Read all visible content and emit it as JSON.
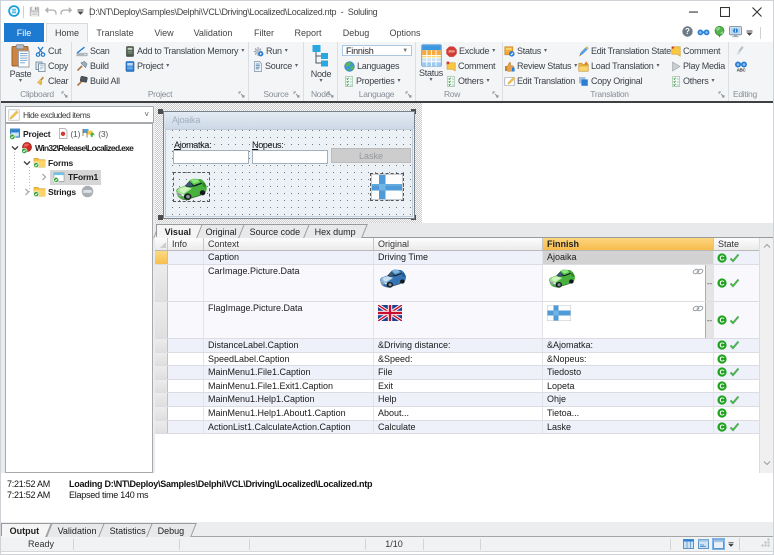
{
  "colors": {
    "accent_blue": "#1e79d0",
    "ribbon_bg": "#f4f5f7",
    "finnish_header_orange": "#f7bb4c",
    "state_green": "#1fa31f",
    "check_green": "#4caf50",
    "selected_row_yellow": "#f6c04f"
  },
  "titlebar": {
    "title_path": "D:\\NT\\Deploy\\Samples\\Delphi\\VCL\\Driving\\Localized\\Localized.ntp",
    "separator": "-",
    "app_name": "Soluling"
  },
  "ribbon_tabs": {
    "file": "File",
    "home": "Home",
    "translate": "Translate",
    "view": "View",
    "validation": "Validation",
    "filter": "Filter",
    "report": "Report",
    "debug": "Debug",
    "options": "Options"
  },
  "ribbon": {
    "clipboard": {
      "label": "Clipboard",
      "paste": "Paste",
      "cut": "Cut",
      "copy": "Copy",
      "clear": "Clear"
    },
    "project": {
      "label": "Project",
      "scan": "Scan",
      "build": "Build",
      "build_all": "Build All",
      "add_tm": "Add to Translation Memory",
      "project": "Project"
    },
    "source": {
      "label": "Source",
      "run": "Run",
      "source": "Source"
    },
    "node": {
      "label": "Node",
      "node": "Node"
    },
    "language": {
      "label": "Language",
      "selected_language": "Finnish",
      "languages": "Languages",
      "properties": "Properties"
    },
    "row": {
      "label": "Row",
      "status": "Status",
      "exclude": "Exclude",
      "comment": "Comment",
      "others": "Others"
    },
    "translation": {
      "label": "Translation",
      "status": "Status",
      "review_status": "Review Status",
      "edit_translation": "Edit Translation",
      "edit_state": "Edit Translation State",
      "load_translation": "Load Translation",
      "copy_original": "Copy Original",
      "comment": "Comment",
      "play_media": "Play Media",
      "others": "Others"
    },
    "editing": {
      "label": "Editing"
    }
  },
  "sidebar": {
    "filter_value": "Hide excluded items",
    "tree": [
      {
        "label": "Project",
        "badge1": "(1)",
        "badge2": "(3)"
      },
      {
        "label": "Win32\\Release\\Localized.exe"
      },
      {
        "label": "Forms"
      },
      {
        "label": "TForm1"
      },
      {
        "label": "Strings"
      }
    ]
  },
  "designer": {
    "form_title": "Ajoaika",
    "label1_prefix": "A",
    "label1_rest": "jomatka:",
    "label2_prefix": "N",
    "label2_rest": "opeus:",
    "button": "Laske"
  },
  "view_tabs": {
    "visual": "Visual",
    "original": "Original",
    "source_code": "Source code",
    "hex_dump": "Hex dump"
  },
  "table": {
    "columns": {
      "info": "Info",
      "context": "Context",
      "original": "Original",
      "finnish": "Finnish",
      "state": "State"
    },
    "state_letter": "C",
    "rows": [
      {
        "context": "Caption",
        "original": "Driving Time",
        "finnish": "Ajoaika",
        "checked": true
      },
      {
        "context": "CarImage.Picture.Data",
        "original": "",
        "finnish": "",
        "checked": true
      },
      {
        "context": "FlagImage.Picture.Data",
        "original": "",
        "finnish": "",
        "checked": true
      },
      {
        "context": "DistanceLabel.Caption",
        "original": "&Driving distance:",
        "finnish": "&Ajomatka:",
        "checked": true
      },
      {
        "context": "SpeedLabel.Caption",
        "original": "&Speed:",
        "finnish": "&Nopeus:",
        "checked": false
      },
      {
        "context": "MainMenu1.File1.Caption",
        "original": "File",
        "finnish": "Tiedosto",
        "checked": true
      },
      {
        "context": "MainMenu1.File1.Exit1.Caption",
        "original": "Exit",
        "finnish": "Lopeta",
        "checked": false
      },
      {
        "context": "MainMenu1.Help1.Caption",
        "original": "Help",
        "finnish": "Ohje",
        "checked": true
      },
      {
        "context": "MainMenu1.Help1.About1.Caption",
        "original": "About...",
        "finnish": "Tietoa...",
        "checked": false
      },
      {
        "context": "ActionList1.CalculateAction.Caption",
        "original": "Calculate",
        "finnish": "Laske",
        "checked": true
      }
    ]
  },
  "log": {
    "entries": [
      {
        "time": "7:21:52 AM",
        "message": "Loading D:\\NT\\Deploy\\Samples\\Delphi\\VCL\\Driving\\Localized\\Localized.ntp",
        "bold": true
      },
      {
        "time": "7:21:52 AM",
        "message": "Elapsed time 140 ms",
        "bold": false
      }
    ]
  },
  "bottom_tabs": {
    "output": "Output",
    "validation": "Validation",
    "statistics": "Statistics",
    "debug": "Debug"
  },
  "statusbar": {
    "ready": "Ready",
    "position": "1/10"
  }
}
